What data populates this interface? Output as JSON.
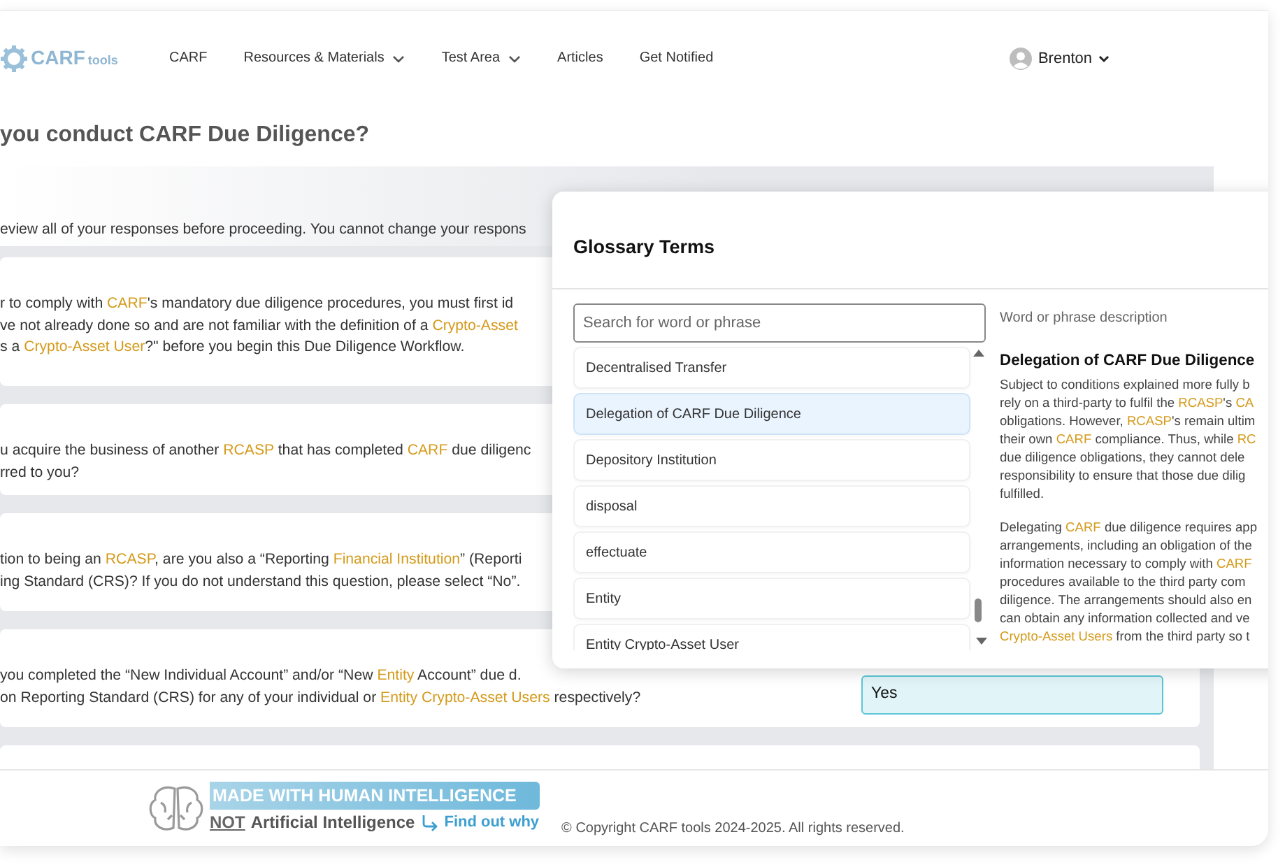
{
  "nav": {
    "logo": {
      "text": "CARF",
      "suffix": "tools"
    },
    "links": [
      {
        "label": "CARF",
        "dropdown": false
      },
      {
        "label": "Resources & Materials",
        "dropdown": true
      },
      {
        "label": "Test Area",
        "dropdown": true
      },
      {
        "label": "Articles",
        "dropdown": false
      },
      {
        "label": "Get Notified",
        "dropdown": false
      }
    ],
    "user": {
      "name": "Brenton"
    }
  },
  "page_title": "you conduct CARF Due Diligence?",
  "notice": [
    [
      "eview all of your responses before proceeding. You cannot change your respons"
    ]
  ],
  "questions": [
    {
      "lines": [
        [
          "r to comply with ",
          {
            "term": "CARF"
          },
          "'s mandatory due diligence procedures, you must first id"
        ],
        [
          "ve not already done so and are not familiar with the definition of a ",
          {
            "term": "Crypto-Asset"
          }
        ],
        [
          "s a ",
          {
            "term": "Crypto-Asset User"
          },
          "?\" before you begin this Due Diligence Workflow."
        ]
      ]
    },
    {
      "lines": [
        [
          "u acquire the business of another ",
          {
            "term": "RCASP"
          },
          " that has completed ",
          {
            "term": "CARF"
          },
          " due diligenc"
        ],
        [
          "rred to you?"
        ]
      ]
    },
    {
      "lines": [
        [
          "tion to being an ",
          {
            "term": "RCASP"
          },
          ", are you also a “Reporting ",
          {
            "term": "Financial Institution"
          },
          "” (Reporti"
        ],
        [
          "ing Standard (CRS)? If you do not understand this question, please select “No”."
        ]
      ]
    },
    {
      "lines": [
        [
          "you completed the “New Individual Account” and/or “New ",
          {
            "term": "Entity"
          },
          " Account” due d."
        ],
        [
          "on Reporting Standard (CRS) for any of your individual or ",
          {
            "term": "Entity Crypto-Asset Users"
          },
          " respectively?"
        ]
      ],
      "answer": "Yes"
    }
  ],
  "glossary": {
    "title": "Glossary Terms",
    "search": {
      "placeholder": "Search for word or phrase"
    },
    "terms": [
      {
        "label": "Decentralised Transfer",
        "selected": false
      },
      {
        "label": "Delegation of CARF Due Diligence",
        "selected": true
      },
      {
        "label": "Depository Institution",
        "selected": false
      },
      {
        "label": "disposal",
        "selected": false
      },
      {
        "label": "effectuate",
        "selected": false
      },
      {
        "label": "Entity",
        "selected": false
      },
      {
        "label": "Entity Crypto-Asset User",
        "selected": false
      }
    ],
    "description_label": "Word or phrase description",
    "heading": "Delegation of CARF Due Diligence",
    "paragraphs": [
      [
        [
          "Subject to conditions explained more fully b"
        ],
        [
          "rely on a third-party to fulfil the ",
          {
            "term": "RCASP"
          },
          "'s ",
          {
            "term": "CA"
          }
        ],
        [
          "obligations. However, ",
          {
            "term": "RCASP"
          },
          "'s remain ultim"
        ],
        [
          "their own ",
          {
            "term": "CARF"
          },
          " compliance. Thus, while ",
          {
            "term": "RC"
          }
        ],
        [
          "due diligence obligations, they cannot dele"
        ],
        [
          "responsibility to ensure that those due dilig"
        ],
        [
          "fulfilled."
        ]
      ],
      [
        [
          "Delegating ",
          {
            "term": "CARF"
          },
          " due diligence requires app"
        ],
        [
          "arrangements, including an obligation of the"
        ],
        [
          "information necessary to comply with ",
          {
            "term": "CARF"
          }
        ],
        [
          "procedures available to the third party com"
        ],
        [
          "diligence. The arrangements should also en"
        ],
        [
          "can obtain any information collected and ve"
        ],
        [
          {
            "term": "Crypto-Asset Users"
          },
          " from the third party so t"
        ]
      ]
    ]
  },
  "footer": {
    "badge": {
      "headline": "MADE WITH HUMAN INTELLIGENCE",
      "not": "NOT",
      "rest": "Artificial Intelligence",
      "link": "Find out why"
    },
    "copyright": "© Copyright CARF tools 2024-2025. All rights reserved."
  }
}
